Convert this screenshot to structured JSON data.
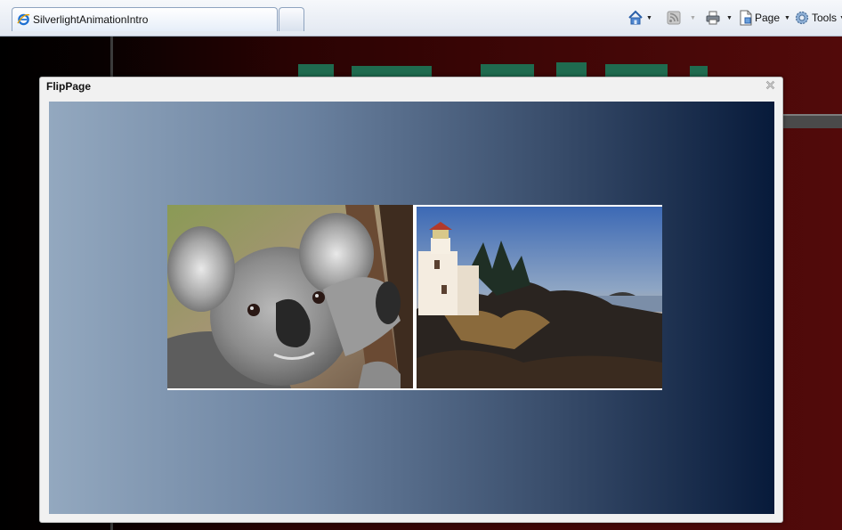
{
  "browser": {
    "tab_title": "SilverlightAnimationIntro",
    "toolbar": {
      "page_label": "Page",
      "tools_label": "Tools",
      "icons": [
        "home-icon",
        "feeds-icon",
        "print-icon",
        "page-icon",
        "tools-gear-icon"
      ]
    }
  },
  "dialog": {
    "title": "FlipPage"
  },
  "flip_book": {
    "left_page_image": "koala-photo",
    "right_page_image": "lighthouse-photo"
  },
  "colors": {
    "dialog_gradient_start": "#93a8bf",
    "dialog_gradient_end": "#071a3a",
    "page_bg_red": "#520a0a"
  }
}
